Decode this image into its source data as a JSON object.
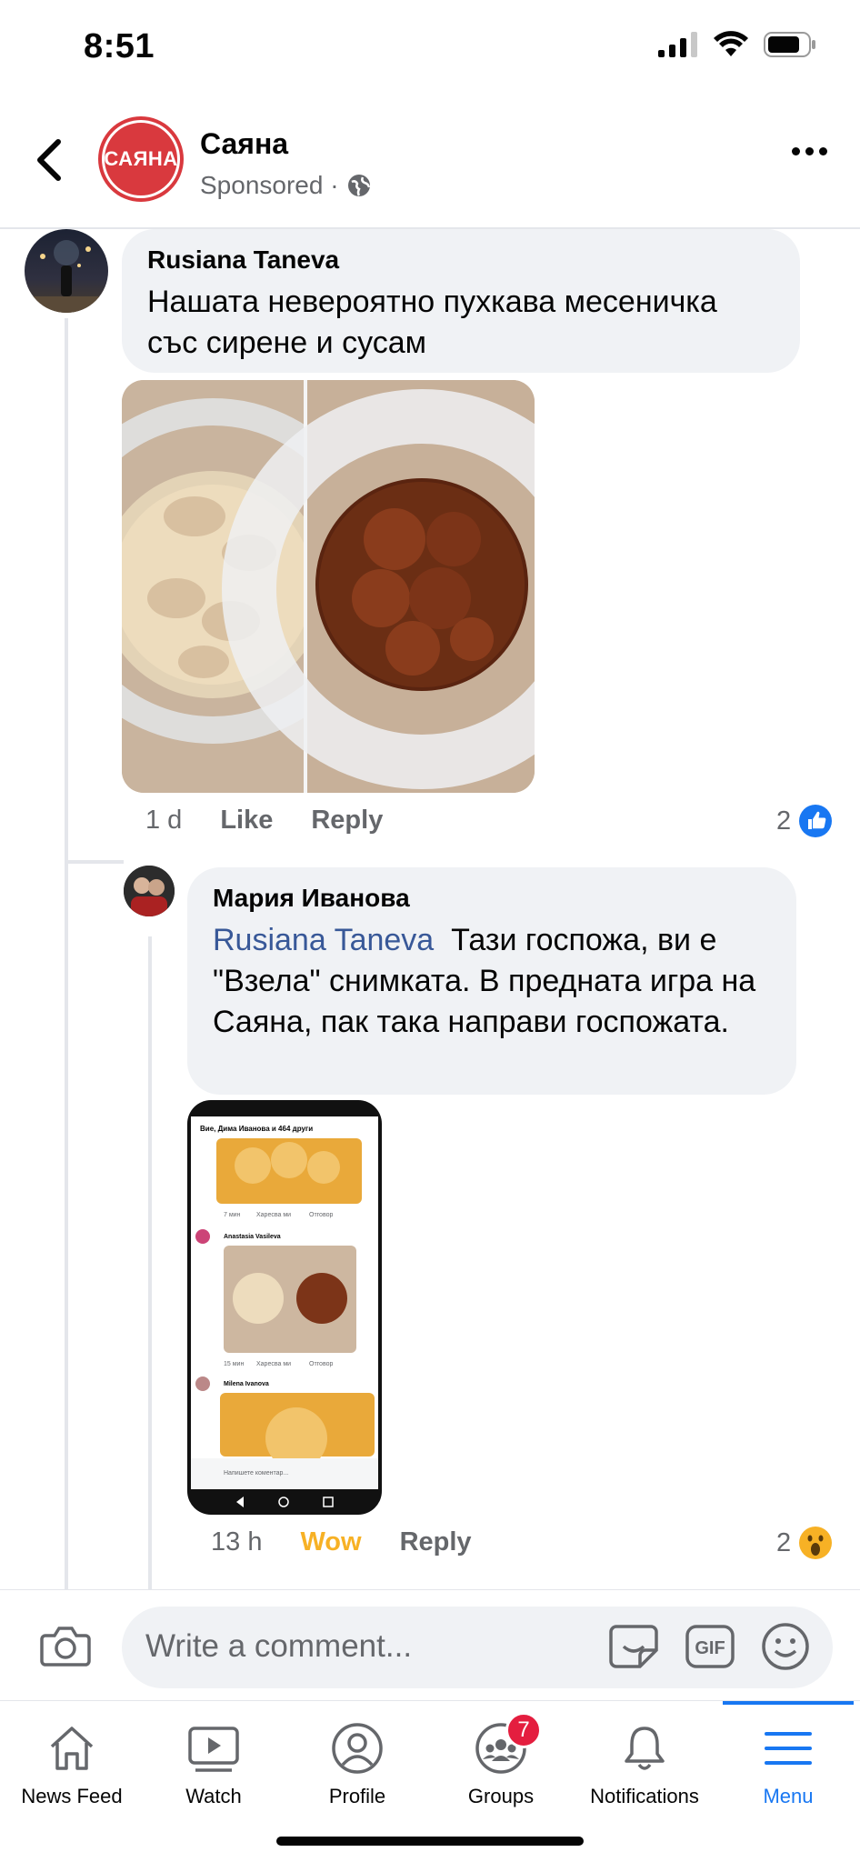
{
  "status_bar": {
    "time": "8:51"
  },
  "header": {
    "page_name": "Саяна",
    "sponsored": "Sponsored ·",
    "logo_text": "САЯНА"
  },
  "comments": [
    {
      "author": "Rusiana Taneva",
      "text": "Нашата невероятно пухкава месеничка със сирене и сусам",
      "time": "1 d",
      "like_label": "Like",
      "reply_label": "Reply",
      "reaction_count": "2",
      "reaction_type": "like-icon"
    },
    {
      "author": "Мария Иванова",
      "mention": "Rusiana Taneva",
      "text": "Тази госпожа, ви е \"Взела\" снимката. В предната игра на Саяна, пак така направи госпожата.",
      "time": "13 h",
      "reaction_label": "Wow",
      "reply_label": "Reply",
      "reaction_count": "2",
      "reaction_type": "wow-icon",
      "reaction_color": "#f7b125"
    }
  ],
  "nested_screenshot": {
    "header": "Вие, Дима Иванова и 464 други",
    "row1_time": "7 мин",
    "row1_like": "Харесва ми",
    "row1_reply": "Отговор",
    "user1": "Anastasia Vasileva",
    "row2_time": "15 мин",
    "row2_like": "Харесва ми",
    "row2_reply": "Отговор",
    "user2": "Milena Ivanova",
    "input_placeholder": "Напишете коментар..."
  },
  "composer": {
    "placeholder": "Write a comment..."
  },
  "tabbar": {
    "tabs": [
      {
        "label": "News Feed",
        "icon": "home-icon"
      },
      {
        "label": "Watch",
        "icon": "watch-icon"
      },
      {
        "label": "Profile",
        "icon": "profile-icon"
      },
      {
        "label": "Groups",
        "icon": "groups-icon",
        "badge": "7"
      },
      {
        "label": "Notifications",
        "icon": "bell-icon"
      },
      {
        "label": "Menu",
        "icon": "menu-icon",
        "active": true
      }
    ]
  },
  "colors": {
    "accent": "#1877f2",
    "bubble": "#f0f2f5",
    "secondary_text": "#65676b",
    "brand_red": "#d9393e"
  }
}
